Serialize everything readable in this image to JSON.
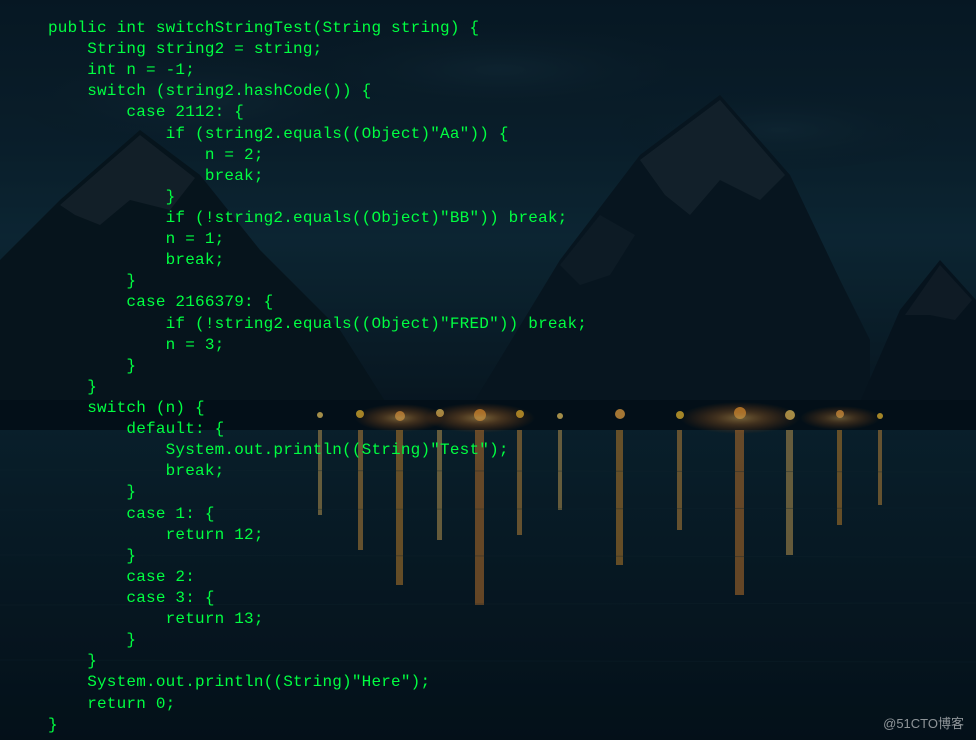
{
  "code": {
    "lines": [
      "public int switchStringTest(String string) {",
      "    String string2 = string;",
      "    int n = -1;",
      "    switch (string2.hashCode()) {",
      "        case 2112: {",
      "            if (string2.equals((Object)\"Aa\")) {",
      "                n = 2;",
      "                break;",
      "            }",
      "            if (!string2.equals((Object)\"BB\")) break;",
      "            n = 1;",
      "            break;",
      "        }",
      "        case 2166379: {",
      "            if (!string2.equals((Object)\"FRED\")) break;",
      "            n = 3;",
      "        }",
      "    }",
      "    switch (n) {",
      "        default: {",
      "            System.out.println((String)\"Test\");",
      "            break;",
      "        }",
      "        case 1: {",
      "            return 12;",
      "        }",
      "        case 2: ",
      "        case 3: {",
      "            return 13;",
      "        }",
      "    }",
      "    System.out.println((String)\"Here\");",
      "    return 0;",
      "}"
    ]
  },
  "watermark": "@51CTO博客"
}
